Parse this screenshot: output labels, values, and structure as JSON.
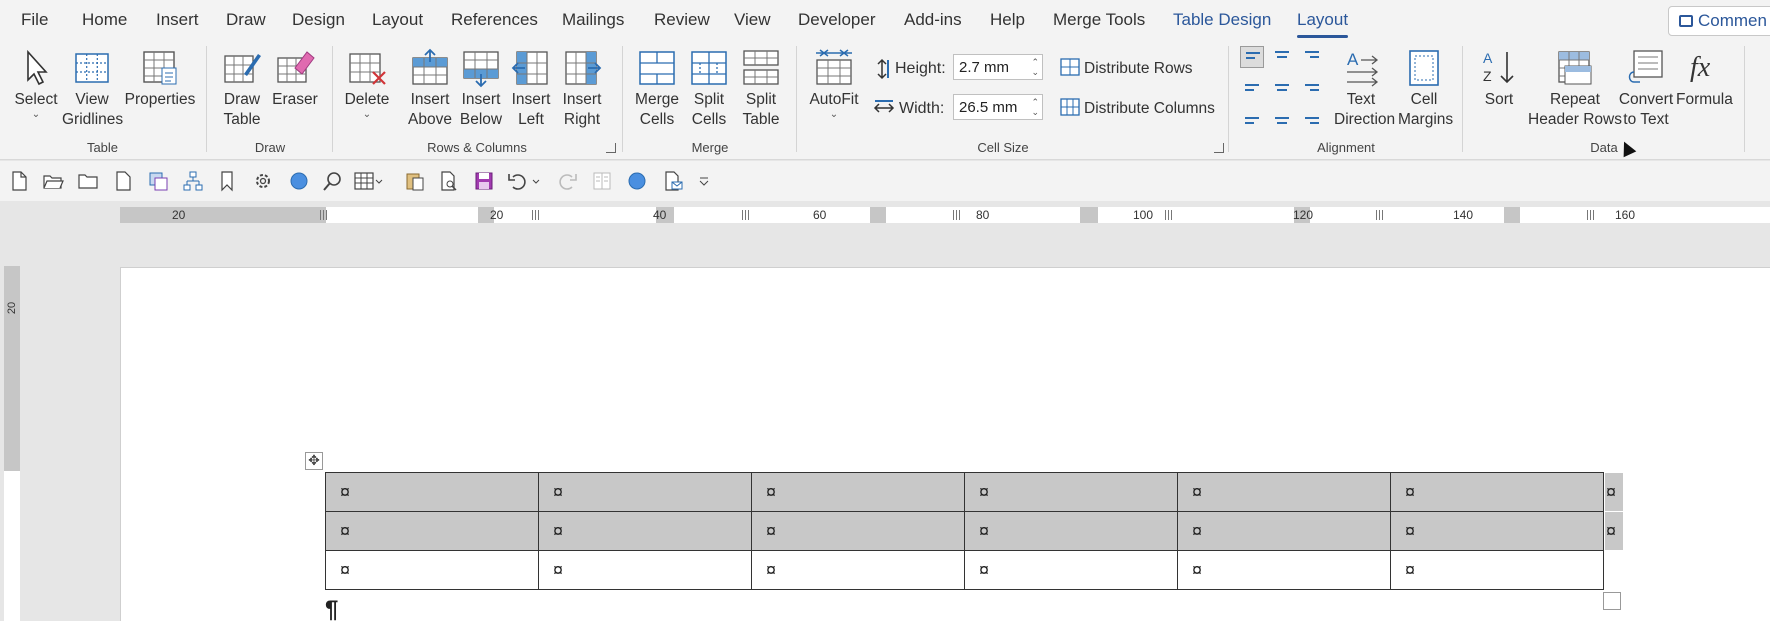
{
  "tabs": {
    "file": "File",
    "home": "Home",
    "insert": "Insert",
    "draw": "Draw",
    "design": "Design",
    "layout_page": "Layout",
    "references": "References",
    "mailings": "Mailings",
    "review": "Review",
    "view": "View",
    "developer": "Developer",
    "addins": "Add-ins",
    "help": "Help",
    "merge_tools": "Merge Tools",
    "table_design": "Table Design",
    "layout_table": "Layout"
  },
  "comments_button": "Commen",
  "ribbon": {
    "table": {
      "select": "Select",
      "view_gridlines_1": "View",
      "view_gridlines_2": "Gridlines",
      "properties": "Properties",
      "label": "Table"
    },
    "draw": {
      "draw_table_1": "Draw",
      "draw_table_2": "Table",
      "eraser": "Eraser",
      "label": "Draw"
    },
    "rows_columns": {
      "delete": "Delete",
      "insert_above_1": "Insert",
      "insert_above_2": "Above",
      "insert_below_1": "Insert",
      "insert_below_2": "Below",
      "insert_left_1": "Insert",
      "insert_left_2": "Left",
      "insert_right_1": "Insert",
      "insert_right_2": "Right",
      "label": "Rows & Columns"
    },
    "merge": {
      "merge_cells_1": "Merge",
      "merge_cells_2": "Cells",
      "split_cells_1": "Split",
      "split_cells_2": "Cells",
      "split_table_1": "Split",
      "split_table_2": "Table",
      "label": "Merge"
    },
    "cell_size": {
      "autofit": "AutoFit",
      "height_label": "Height:",
      "height_value": "2.7 mm",
      "width_label": "Width:",
      "width_value": "26.5 mm",
      "distribute_rows": "Distribute Rows",
      "distribute_columns": "Distribute Columns",
      "label": "Cell Size"
    },
    "alignment": {
      "text_direction_1": "Text",
      "text_direction_2": "Direction",
      "cell_margins_1": "Cell",
      "cell_margins_2": "Margins",
      "label": "Alignment"
    },
    "data": {
      "sort": "Sort",
      "repeat_header_1": "Repeat",
      "repeat_header_2": "Header Rows",
      "convert_1": "Convert",
      "convert_2": "to Text",
      "formula": "Formula",
      "label": "Data"
    }
  },
  "ruler": {
    "h_numbers": [
      "20",
      "20",
      "40",
      "60",
      "80",
      "100",
      "120",
      "140",
      "160"
    ],
    "v_number": "20"
  },
  "table": {
    "cell_mark": "¤",
    "rows": [
      [
        "¤",
        "¤",
        "¤",
        "¤",
        "¤",
        "¤"
      ],
      [
        "¤",
        "¤",
        "¤",
        "¤",
        "¤",
        "¤"
      ],
      [
        "¤",
        "¤",
        "¤",
        "¤",
        "¤",
        "¤"
      ]
    ],
    "row_end_marks": [
      "¤",
      "¤"
    ],
    "paragraph_mark": "¶"
  },
  "colors": {
    "accent": "#2b579a",
    "selection": "#c8c8c8"
  }
}
